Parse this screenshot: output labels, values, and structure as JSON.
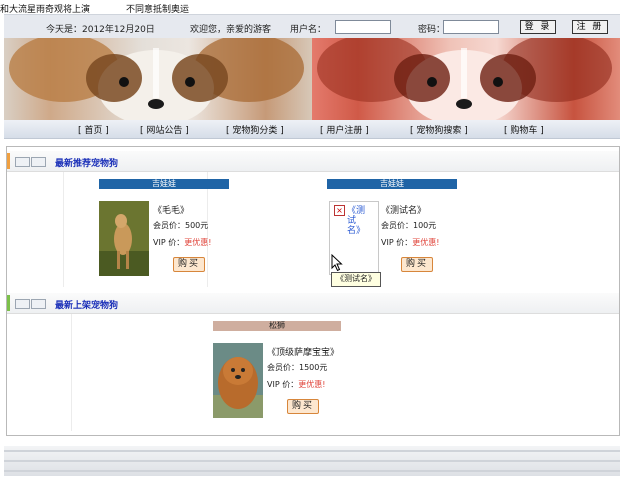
{
  "ticker": {
    "left_text": "和大流星雨奇观将上演",
    "right_text": "不同意抵制奥运"
  },
  "topbar": {
    "date_text": "今天是：2012年12月20日",
    "welcome_text": "欢迎您，亲爱的游客",
    "username_label": "用户名：",
    "username_value": "",
    "password_label": "密码：",
    "password_value": "",
    "login_label": "登 录",
    "register_label": "注 册"
  },
  "nav": {
    "items": [
      {
        "label": "[ 首页 ]"
      },
      {
        "label": "[ 网站公告 ]"
      },
      {
        "label": "[ 宠物狗分类 ]"
      },
      {
        "label": "[ 用户注册 ]"
      },
      {
        "label": "[ 宠物狗搜索 ]"
      },
      {
        "label": "[ 购物车 ]"
      }
    ]
  },
  "sections": [
    {
      "title": "最新推荐宠物狗",
      "products": [
        {
          "category": "吉娃娃",
          "name": "《毛毛》",
          "member_price_label": "会员价：",
          "member_price": "500元",
          "vip_price_label": "VIP 价：",
          "vip_price": "更优惠!",
          "buy_label": "购买"
        },
        {
          "category": "吉娃娃",
          "image_alt": "《测试名》",
          "name": "《测试名》",
          "member_price_label": "会员价：",
          "member_price": "100元",
          "vip_price_label": "VIP 价：",
          "vip_price": "更优惠!",
          "buy_label": "购买"
        }
      ]
    },
    {
      "title": "最新上架宠物狗",
      "products": [
        {
          "category": "松狮",
          "name": "《顶级萨摩宝宝》",
          "member_price_label": "会员价：",
          "member_price": "1500元",
          "vip_price_label": "VIP 价：",
          "vip_price": "更优惠!",
          "buy_label": "购买"
        }
      ]
    }
  ],
  "tooltip": "《测试名》",
  "colors": {
    "section_title": "#1a2fb8",
    "category_bar_blue": "#1f64a6",
    "category_bar_tan": "#cfae9f",
    "vip_price_red": "#e0443a",
    "buy_button_bg": "#fde7cf",
    "section_bar_orange": "#f0a040",
    "section_bar_green": "#7cc04a"
  }
}
